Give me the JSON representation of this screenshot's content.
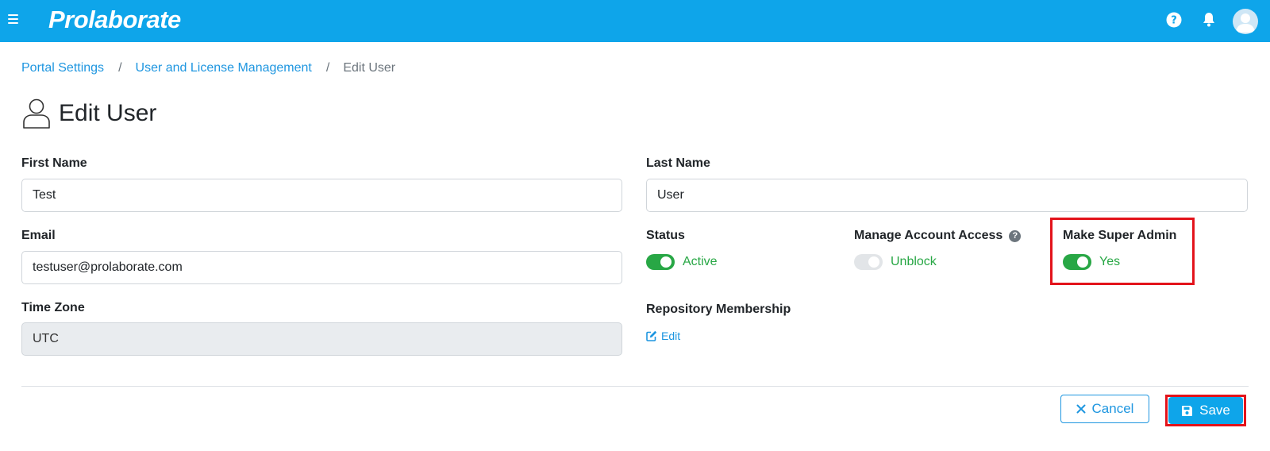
{
  "app": {
    "logo_text": "Prolaborate",
    "brand_color": "#0ea5ea"
  },
  "header": {
    "icons": [
      "menu-icon",
      "help-icon",
      "bell-icon",
      "avatar-icon"
    ]
  },
  "breadcrumb": {
    "items": [
      "Portal Settings",
      "User and License Management"
    ],
    "separator": "/",
    "current": "Edit User"
  },
  "page": {
    "title": "Edit User",
    "title_icon": "user-outline-icon"
  },
  "form": {
    "first_name": {
      "label": "First Name",
      "value": "Test"
    },
    "last_name": {
      "label": "Last Name",
      "value": "User"
    },
    "email": {
      "label": "Email",
      "value": "testuser@prolaborate.com"
    },
    "time_zone": {
      "label": "Time Zone",
      "value": "UTC"
    },
    "status": {
      "label": "Status",
      "toggle_on": true,
      "text": "Active"
    },
    "manage_access": {
      "label": "Manage Account Access",
      "help": "?",
      "toggle_on": false,
      "text": "Unblock"
    },
    "super_admin": {
      "label": "Make Super Admin",
      "toggle_on": true,
      "text": "Yes"
    },
    "repository": {
      "label": "Repository Membership",
      "edit_label": "Edit"
    }
  },
  "actions": {
    "cancel_label": "Cancel",
    "save_label": "Save"
  },
  "colors": {
    "link": "#1e96e0",
    "success": "#28a745",
    "highlight": "#e3131b"
  }
}
